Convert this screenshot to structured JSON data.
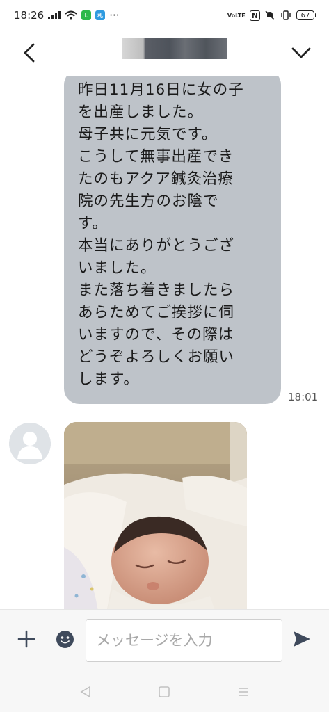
{
  "status_bar": {
    "time": "18:26",
    "more": "···",
    "volte": "VoLTE",
    "nfc": "N",
    "battery": "67"
  },
  "header": {
    "back_icon": "chevron-left-icon",
    "menu_icon": "chevron-down-icon"
  },
  "messages": [
    {
      "type": "text",
      "lines": [
        "昨日11月16日に女の子",
        "を出産しました。",
        "母子共に元気です。",
        "こうして無事出産でき",
        "たのもアクア鍼灸治療",
        "院の先生方のお陰で",
        "す。",
        "本当にありがとうござ",
        "いました。",
        "また落ち着きましたら",
        "あらためてご挨拶に伺",
        "いますので、その際は",
        "どうぞよろしくお願い",
        "します。"
      ],
      "time": "18:01"
    },
    {
      "type": "photo",
      "subject": "newborn-baby-photo"
    }
  ],
  "input_bar": {
    "placeholder": "メッセージを入力",
    "add_icon": "plus-icon",
    "sticker_icon": "emoji-icon",
    "send_icon": "send-icon"
  },
  "colors": {
    "bubble": "#bec3c9",
    "background": "#ffffff",
    "accent": "#3f4a5c"
  }
}
